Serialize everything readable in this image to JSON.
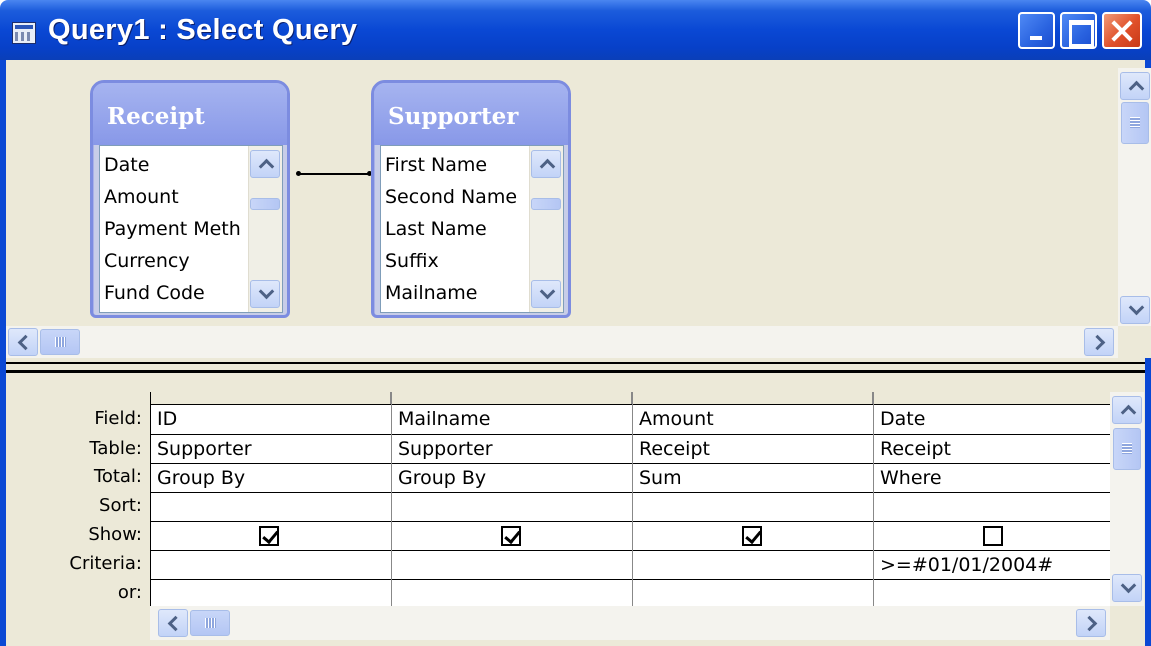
{
  "window": {
    "title": "Query1 : Select Query",
    "icons": [
      "query-icon",
      "minimize-icon",
      "maximize-icon",
      "close-icon"
    ]
  },
  "tables": [
    {
      "name": "Receipt",
      "fields": [
        "Date",
        "Amount",
        "Payment Meth",
        "Currency",
        "Fund Code"
      ]
    },
    {
      "name": "Supporter",
      "fields": [
        "First Name",
        "Second Name",
        "Last Name",
        "Suffix",
        "Mailname"
      ]
    }
  ],
  "grid": {
    "row_labels": [
      "Field:",
      "Table:",
      "Total:",
      "Sort:",
      "Show:",
      "Criteria:",
      "or:"
    ],
    "columns": [
      {
        "field": "ID",
        "table": "Supporter",
        "total": "Group By",
        "sort": "",
        "show": true,
        "criteria": "",
        "or": ""
      },
      {
        "field": "Mailname",
        "table": "Supporter",
        "total": "Group By",
        "sort": "",
        "show": true,
        "criteria": "",
        "or": ""
      },
      {
        "field": "Amount",
        "table": "Receipt",
        "total": "Sum",
        "sort": "",
        "show": true,
        "criteria": "",
        "or": ""
      },
      {
        "field": "Date",
        "table": "Receipt",
        "total": "Where",
        "sort": "",
        "show": false,
        "criteria": ">=#01/01/2004#",
        "or": ""
      }
    ]
  },
  "colors": {
    "titlebar": "#0a48d4",
    "table_header": "#8898e8",
    "pane_background": "#ece9d8",
    "close_button": "#e0502a"
  }
}
